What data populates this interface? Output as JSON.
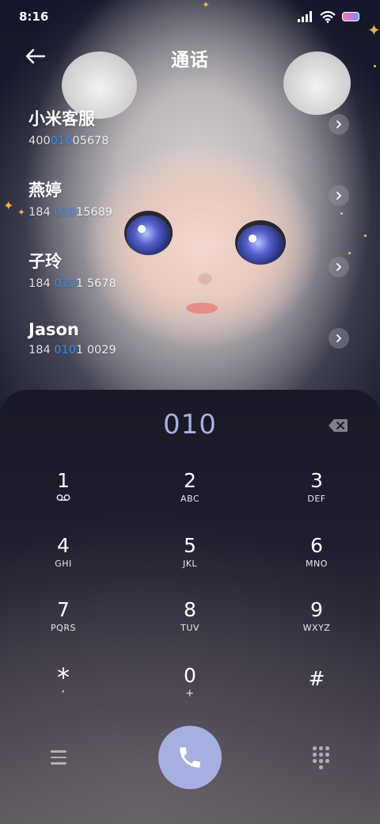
{
  "status_bar": {
    "time": "8:16",
    "icons": [
      "signal-icon",
      "wifi-icon",
      "battery-icon"
    ]
  },
  "header": {
    "title": "通话",
    "back_icon": "arrow-left-icon"
  },
  "contacts": [
    {
      "name": "小米客服",
      "number_pre": "400",
      "number_hl": "010",
      "number_post": "05678"
    },
    {
      "name": "燕婷",
      "number_pre": "184 ",
      "number_hl": "010",
      "number_post": "15689"
    },
    {
      "name": "子玲",
      "number_pre": "184 ",
      "number_hl": "010",
      "number_post": "1 5678"
    },
    {
      "name": "Jason",
      "number_pre": "184 ",
      "number_hl": "010",
      "number_post": "1 0029"
    }
  ],
  "dialer": {
    "display": "010",
    "keys": [
      {
        "digit": "1",
        "sub": "ꝏ"
      },
      {
        "digit": "2",
        "sub": "ABC"
      },
      {
        "digit": "3",
        "sub": "DEF"
      },
      {
        "digit": "4",
        "sub": "GHI"
      },
      {
        "digit": "5",
        "sub": "JKL"
      },
      {
        "digit": "6",
        "sub": "MNO"
      },
      {
        "digit": "7",
        "sub": "PQRS"
      },
      {
        "digit": "8",
        "sub": "TUV"
      },
      {
        "digit": "9",
        "sub": "WXYZ"
      },
      {
        "digit": "*",
        "sub": ","
      },
      {
        "digit": "0",
        "sub": "+"
      },
      {
        "digit": "#",
        "sub": ""
      }
    ]
  },
  "colors": {
    "highlight": "#2f8ff2",
    "call_button": "#a6afe0",
    "dial_text": "#a7b0de"
  }
}
